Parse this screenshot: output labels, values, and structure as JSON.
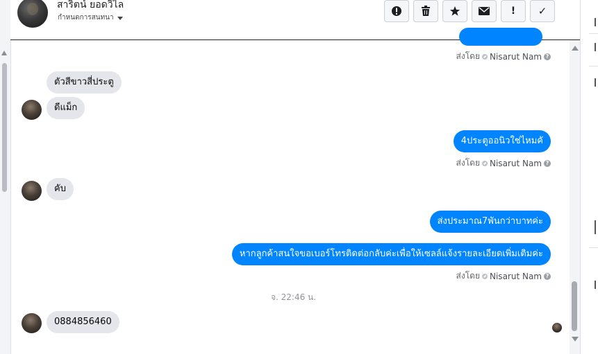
{
  "header": {
    "contact_name": "สาริตน์ ยอดวิไล",
    "subtitle": "กำหนดการสนทนา"
  },
  "toolbar": {
    "buttons": [
      {
        "name": "report-button",
        "icon": "alert-circle-icon"
      },
      {
        "name": "delete-button",
        "icon": "trash-icon"
      },
      {
        "name": "star-button",
        "icon": "star-icon"
      },
      {
        "name": "mark-unread-button",
        "icon": "envelope-icon"
      },
      {
        "name": "spam-button",
        "icon": "exclamation-icon",
        "glyph": "!"
      },
      {
        "name": "done-button",
        "icon": "checkmark-icon",
        "glyph": "✓"
      }
    ]
  },
  "sent_by": {
    "prefix": "ส่งโดย",
    "sender": "Nisarut Nam",
    "help": "?"
  },
  "messages": {
    "in1": "ตัวสีขาวสี่ประตู",
    "in2": "ดีแม็ก",
    "out1": "4ประตูออนิวใช่ไหมคั",
    "in3": "คับ",
    "out2": "ส่งประมาณ7พันกว่าบาทค่ะ",
    "out3": "หากลูกค้าสนใจขอเบอร์โทรติดต่อกลับค่ะเพื่อให้เซลล์แจ้งรายละเอียดเพิ่มเติมค่ะ",
    "timestamp": "จ. 22:46 น.",
    "in4": "0884856460"
  },
  "colors": {
    "outgoing_bubble": "#0084ff",
    "incoming_bubble": "#e4e6eb"
  }
}
